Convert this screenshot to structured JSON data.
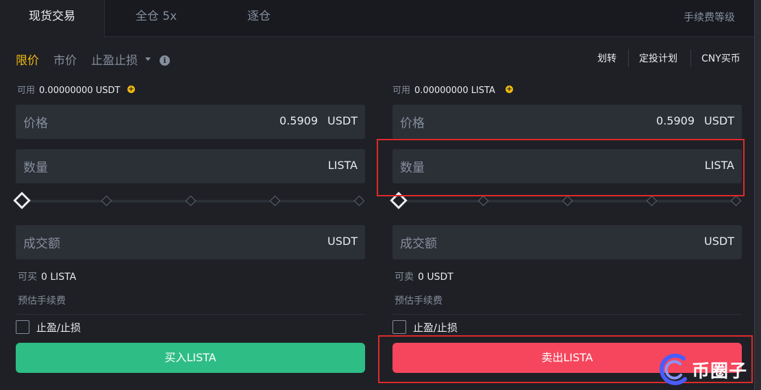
{
  "topbar": {
    "tabs": [
      {
        "label": "现货交易"
      },
      {
        "label": "全仓 5x"
      },
      {
        "label": "逐仓"
      }
    ],
    "fee_link": "手续费等级"
  },
  "order_types": {
    "limit": "限价",
    "market": "市价",
    "stop": "止盈止损",
    "info_glyph": "i"
  },
  "links": {
    "transfer": "划转",
    "dca": "定投计划",
    "cny_buy": "CNY买币"
  },
  "buy_panel": {
    "available_label": "可用",
    "available_value": "0.00000000 USDT",
    "price_label": "价格",
    "price_value": "0.5909",
    "price_unit": "USDT",
    "amount_label": "数量",
    "amount_unit": "LISTA",
    "total_label": "成交额",
    "total_unit": "USDT",
    "max_label": "可买",
    "max_value": "0 LISTA",
    "fee_label": "预估手续费",
    "tpsl_label": "止盈/止损",
    "button_label": "买入LISTA"
  },
  "sell_panel": {
    "available_label": "可用",
    "available_value": "0.00000000 LISTA",
    "price_label": "价格",
    "price_value": "0.5909",
    "price_unit": "USDT",
    "amount_label": "数量",
    "amount_unit": "LISTA",
    "total_label": "成交额",
    "total_unit": "USDT",
    "max_label": "可卖",
    "max_value": "0 USDT",
    "fee_label": "预估手续费",
    "tpsl_label": "止盈/止损",
    "button_label": "卖出LISTA"
  },
  "slider_levels_percent": [
    0,
    25,
    50,
    75,
    100
  ],
  "slider_value_percent": 0,
  "watermark": {
    "text": "币圈子"
  },
  "colors": {
    "accent": "#f0b90b",
    "buy": "#2ebd85",
    "sell": "#f6465d",
    "highlight": "#e02a2a"
  }
}
